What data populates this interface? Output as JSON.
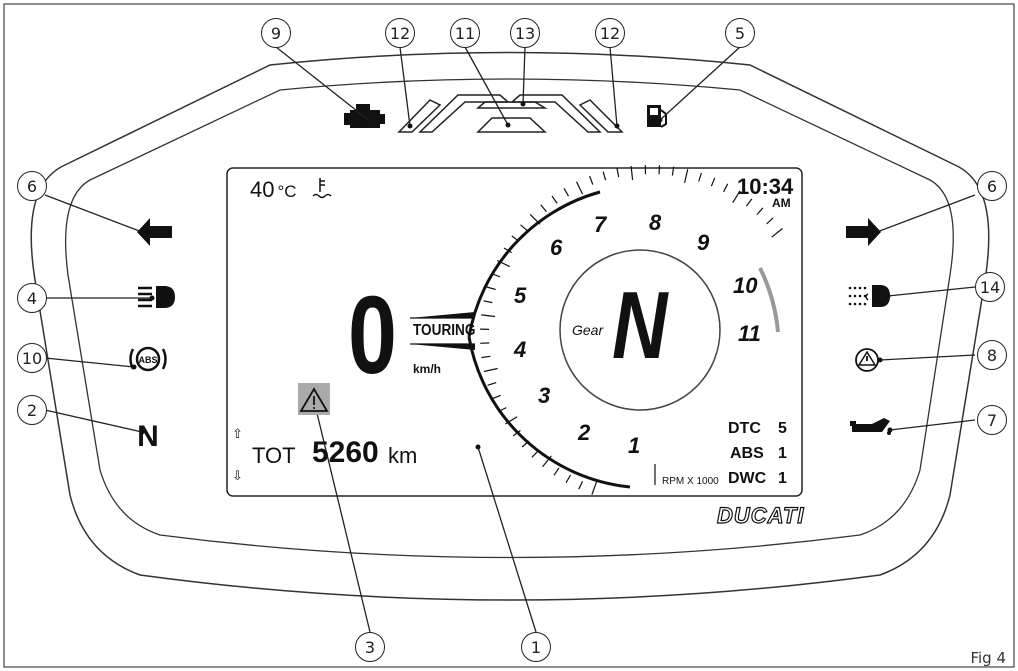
{
  "figure_label": "Fig 4",
  "lcd": {
    "temperature": "40",
    "temperature_unit": "°C",
    "clock_time": "10:34",
    "clock_ampm": "AM",
    "speed": "0",
    "riding_mode": "TOURING",
    "speed_unit": "km/h",
    "gear_label": "Gear",
    "gear_value": "N",
    "odometer_label": "TOT",
    "odometer_value": "5260",
    "odometer_unit": "km",
    "rpm_label": "RPM X 1000",
    "dtc_label": "DTC",
    "dtc_value": "5",
    "abs_label": "ABS",
    "abs_value": "1",
    "dwc_label": "DWC",
    "dwc_value": "1",
    "tach_numbers": [
      "1",
      "2",
      "3",
      "4",
      "5",
      "6",
      "7",
      "8",
      "9",
      "10",
      "11"
    ]
  },
  "brand": "DUCATI",
  "indicators": {
    "abs_text": "ABS",
    "neutral_text": "N"
  },
  "callouts": [
    "9",
    "12",
    "11",
    "13",
    "12",
    "5",
    "6",
    "6",
    "4",
    "14",
    "10",
    "8",
    "2",
    "7",
    "3",
    "1"
  ]
}
